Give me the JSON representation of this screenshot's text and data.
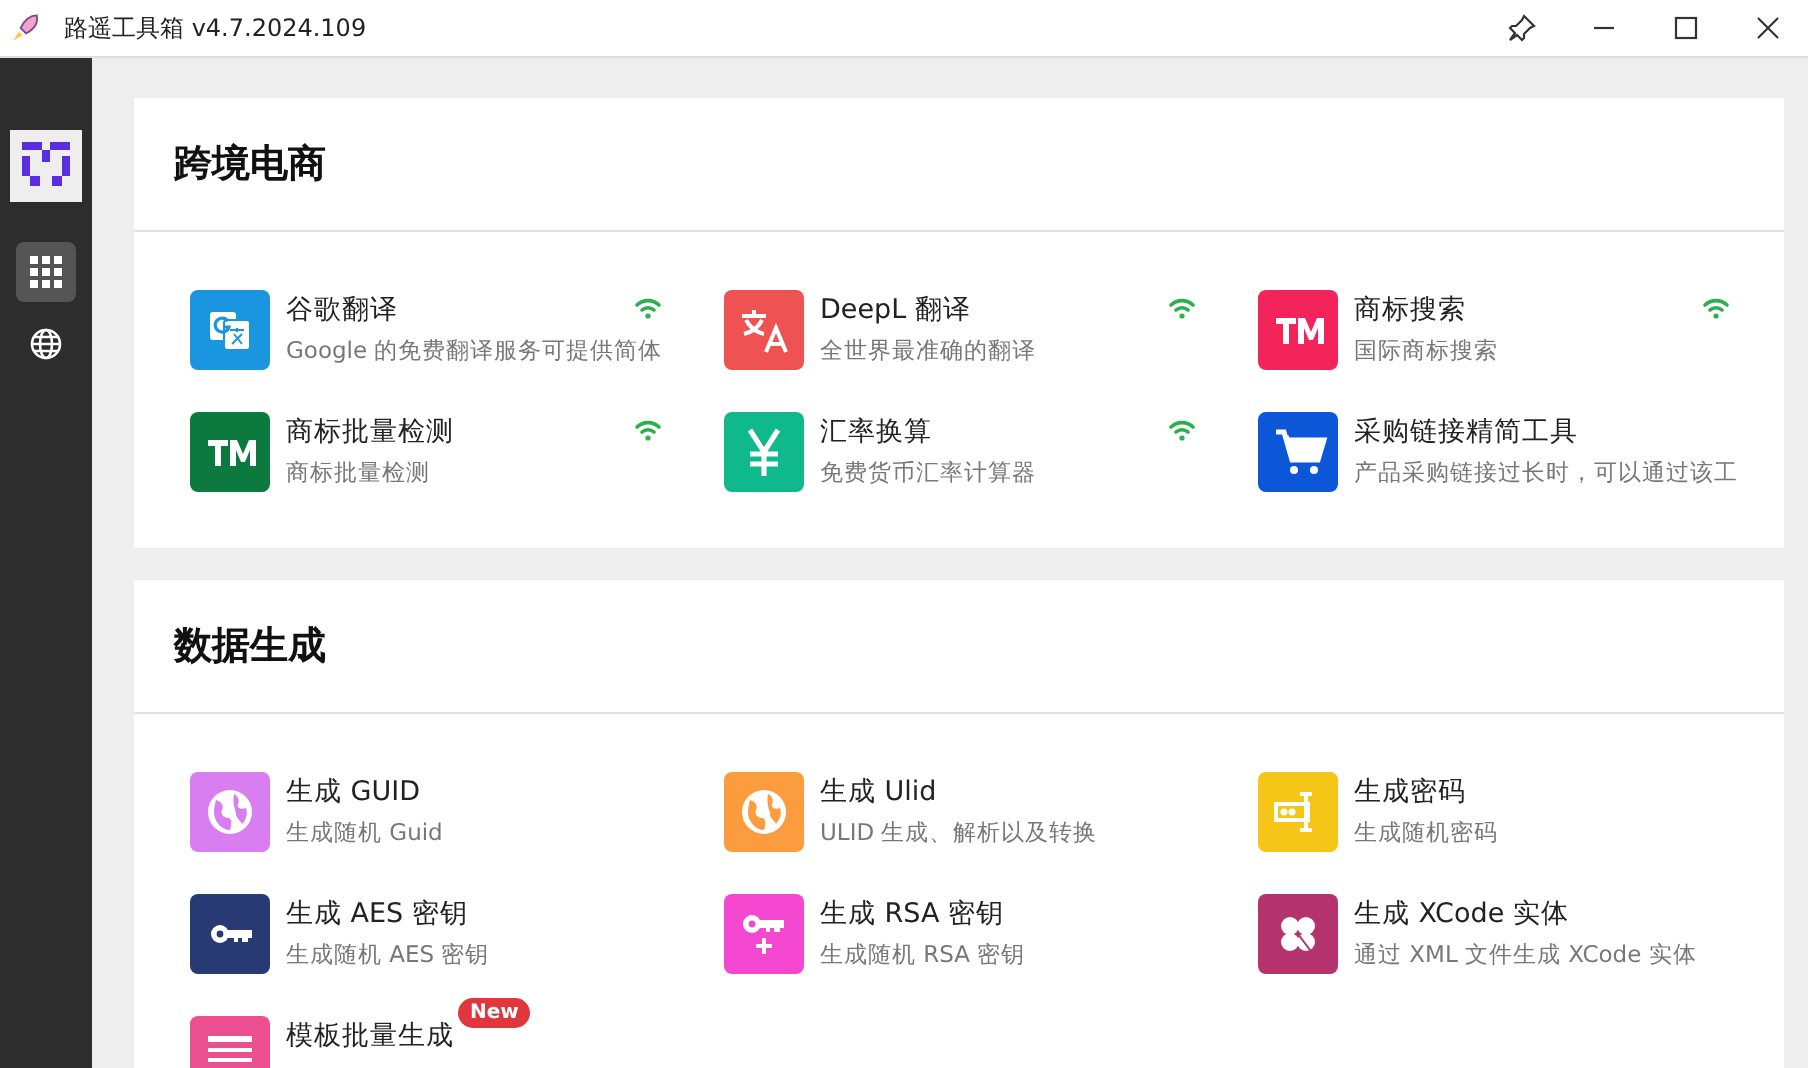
{
  "window": {
    "title": "路遥工具箱 v4.7.2024.109"
  },
  "sidebar": {
    "items": [
      {
        "kind": "apps",
        "selected": true
      },
      {
        "kind": "globe",
        "selected": false
      }
    ]
  },
  "sections": [
    {
      "title": "跨境电商",
      "items": [
        {
          "name": "谷歌翻译",
          "description": "Google 的免费翻译服务可提供简体",
          "kind": "google-translate",
          "color": "#1a96e0",
          "online": true
        },
        {
          "name": "DeepL 翻译",
          "description": "全世界最准确的翻译",
          "kind": "translate",
          "color": "#ee5253",
          "online": true
        },
        {
          "name": "商标搜索",
          "description": "国际商标搜索",
          "kind": "tm",
          "color": "#f3245a",
          "online": true
        },
        {
          "name": "商标批量检测",
          "description": "商标批量检测",
          "kind": "tm",
          "color": "#0c7a3e",
          "online": true
        },
        {
          "name": "汇率换算",
          "description": "免费货币汇率计算器",
          "kind": "yen",
          "color": "#0fb98c",
          "online": true
        },
        {
          "name": "采购链接精简工具",
          "description": "产品采购链接过长时，可以通过该工",
          "kind": "cart",
          "color": "#0c56d8",
          "online": false
        }
      ]
    },
    {
      "title": "数据生成",
      "items": [
        {
          "name": "生成 GUID",
          "description": "生成随机 Guid",
          "kind": "globe",
          "color": "#d97ef0",
          "online": false
        },
        {
          "name": "生成 Ulid",
          "description": "ULID 生成、解析以及转换",
          "kind": "globe",
          "color": "#fb9c3e",
          "online": false
        },
        {
          "name": "生成密码",
          "description": "生成随机密码",
          "kind": "cursor",
          "color": "#f5c518",
          "online": false
        },
        {
          "name": "生成 AES 密钥",
          "description": "生成随机 AES 密钥",
          "kind": "key",
          "color": "#273a73",
          "online": false
        },
        {
          "name": "生成 RSA 密钥",
          "description": "生成随机 RSA 密钥",
          "kind": "key-plus",
          "color": "#f448d0",
          "online": false
        },
        {
          "name": "生成 XCode 实体",
          "description": "通过 XML 文件生成 XCode 实体",
          "kind": "clover",
          "color": "#b4336d",
          "online": false
        },
        {
          "name": "模板批量生成",
          "kind": "table",
          "color": "#ec4f8f",
          "online": false,
          "badge": "New"
        }
      ]
    }
  ]
}
